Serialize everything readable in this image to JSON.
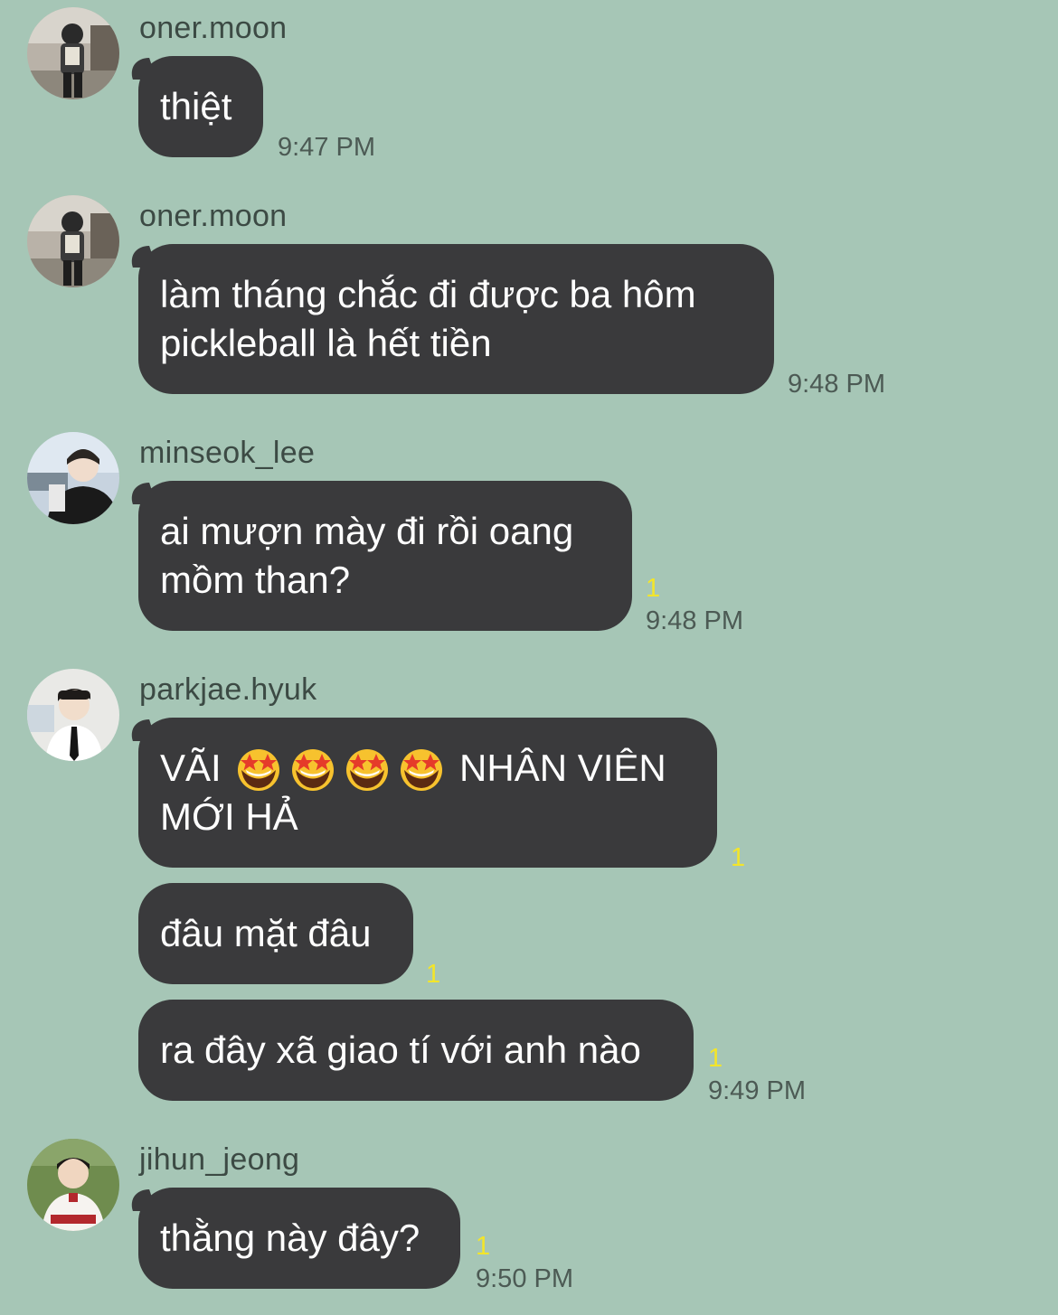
{
  "colors": {
    "background": "#a6c6b6",
    "bubble": "#3a3a3c",
    "unread": "#f3e52a"
  },
  "messages": [
    {
      "sender": "oner.moon",
      "avatar_icon": "user-avatar-icon",
      "bubbles": [
        {
          "lines": [
            "thiệt"
          ],
          "unread": "",
          "time": "9:47 PM"
        }
      ]
    },
    {
      "sender": "oner.moon",
      "avatar_icon": "user-avatar-icon",
      "bubbles": [
        {
          "lines": [
            "làm tháng chắc đi được ba hôm",
            "pickleball là hết tiền"
          ],
          "unread": "",
          "time": "9:48 PM"
        }
      ]
    },
    {
      "sender": "minseok_lee",
      "avatar_icon": "user-avatar-icon",
      "bubbles": [
        {
          "lines": [
            "ai mượn mày đi rồi oang",
            "mồm than?"
          ],
          "unread": "1",
          "time": "9:48 PM"
        }
      ]
    },
    {
      "sender": "parkjae.hyuk",
      "avatar_icon": "user-avatar-icon",
      "bubbles": [
        {
          "line1_prefix": "VÃI",
          "emoji": "star-struck-emoji-icon",
          "emoji_count": 4,
          "line1_suffix": "NHÂN VIÊN",
          "lines": [
            "MỚI HẢ"
          ],
          "unread": "1",
          "time": ""
        },
        {
          "lines": [
            "đâu mặt đâu"
          ],
          "unread": "1",
          "time": ""
        },
        {
          "lines": [
            "ra đây xã giao tí với anh nào"
          ],
          "unread": "1",
          "time": "9:49 PM"
        }
      ]
    },
    {
      "sender": "jihun_jeong",
      "avatar_icon": "user-avatar-icon",
      "bubbles": [
        {
          "lines": [
            "thằng này đây?"
          ],
          "unread": "1",
          "time": "9:50 PM"
        }
      ]
    }
  ]
}
